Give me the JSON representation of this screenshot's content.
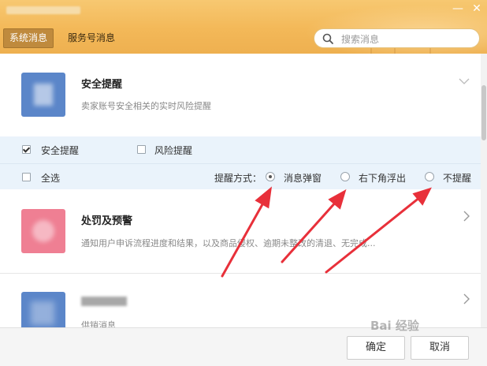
{
  "header": {
    "tabs": [
      {
        "label": "系统消息",
        "active": true
      },
      {
        "label": "服务号消息",
        "active": false
      }
    ],
    "search": {
      "placeholder": "搜索消息"
    },
    "controls": [
      "minimize-icon",
      "close-icon"
    ]
  },
  "cards": [
    {
      "title": "安全提醒",
      "desc": "卖家账号安全相关的实时风险提醒",
      "icon_color": "#5b86c9",
      "expander": "chevron-down-icon"
    },
    {
      "title": "处罚及预警",
      "desc": "通知用户申诉流程进度和结果，以及商品侵权、逾期未整改的清退、无完成...",
      "icon_color": "#ef7f93",
      "expander": "chevron-right-icon"
    },
    {
      "title": "",
      "desc": "供销消息",
      "icon_color": "#5b86c9",
      "expander": "chevron-right-icon"
    }
  ],
  "options": {
    "row1": [
      {
        "label": "安全提醒",
        "checked": true
      },
      {
        "label": "风险提醒",
        "checked": false
      }
    ],
    "select_all": {
      "label": "全选",
      "checked": false
    },
    "mode_label": "提醒方式：",
    "modes": [
      {
        "label": "消息弹窗",
        "selected": true
      },
      {
        "label": "右下角浮出",
        "selected": false
      },
      {
        "label": "不提醒",
        "selected": false
      }
    ]
  },
  "footer": {
    "confirm": "确定",
    "cancel": "取消"
  },
  "annotation": {
    "arrow_color": "#e8303a"
  },
  "watermark": "Bai 经验"
}
